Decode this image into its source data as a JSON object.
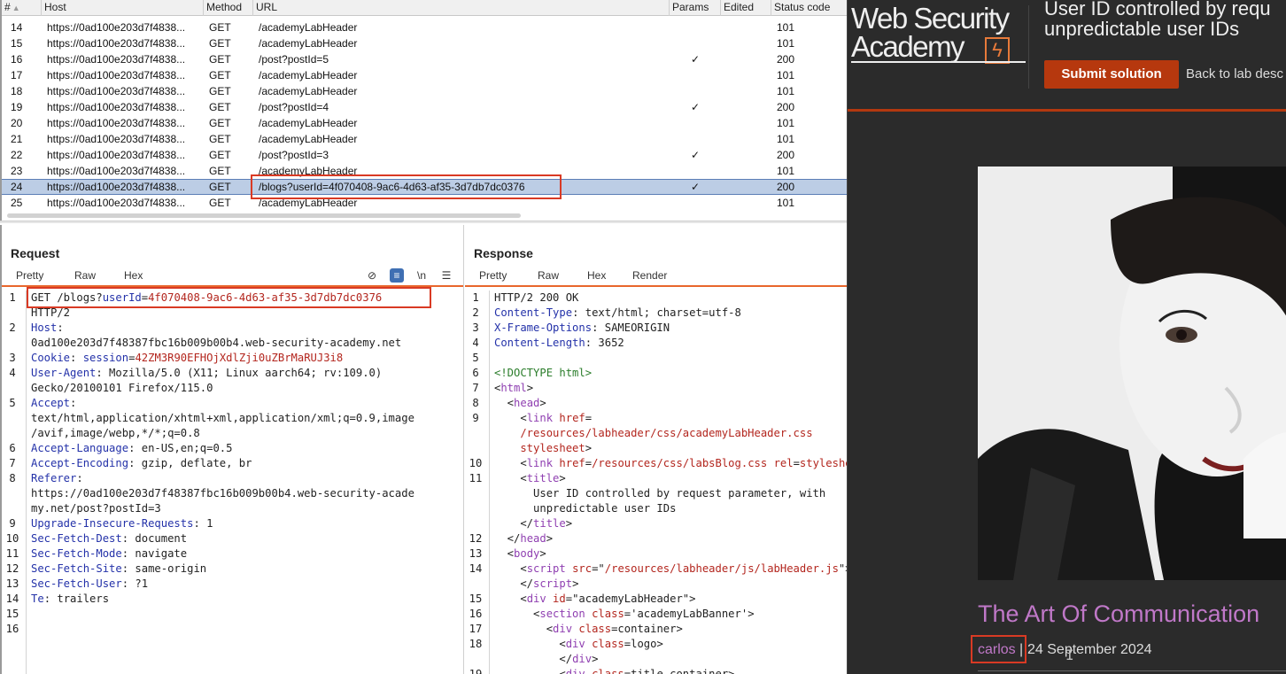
{
  "history": {
    "columns": {
      "num": "#",
      "host": "Host",
      "method": "Method",
      "url": "URL",
      "params": "Params",
      "edited": "Edited",
      "status": "Status code"
    },
    "rows": [
      {
        "num": "14",
        "host": "https://0ad100e203d7f4838...",
        "method": "GET",
        "url": "/academyLabHeader",
        "params": "",
        "status": "101"
      },
      {
        "num": "15",
        "host": "https://0ad100e203d7f4838...",
        "method": "GET",
        "url": "/academyLabHeader",
        "params": "",
        "status": "101"
      },
      {
        "num": "16",
        "host": "https://0ad100e203d7f4838...",
        "method": "GET",
        "url": "/post?postId=5",
        "params": "✓",
        "status": "200"
      },
      {
        "num": "17",
        "host": "https://0ad100e203d7f4838...",
        "method": "GET",
        "url": "/academyLabHeader",
        "params": "",
        "status": "101"
      },
      {
        "num": "18",
        "host": "https://0ad100e203d7f4838...",
        "method": "GET",
        "url": "/academyLabHeader",
        "params": "",
        "status": "101"
      },
      {
        "num": "19",
        "host": "https://0ad100e203d7f4838...",
        "method": "GET",
        "url": "/post?postId=4",
        "params": "✓",
        "status": "200"
      },
      {
        "num": "20",
        "host": "https://0ad100e203d7f4838...",
        "method": "GET",
        "url": "/academyLabHeader",
        "params": "",
        "status": "101"
      },
      {
        "num": "21",
        "host": "https://0ad100e203d7f4838...",
        "method": "GET",
        "url": "/academyLabHeader",
        "params": "",
        "status": "101"
      },
      {
        "num": "22",
        "host": "https://0ad100e203d7f4838...",
        "method": "GET",
        "url": "/post?postId=3",
        "params": "✓",
        "status": "200"
      },
      {
        "num": "23",
        "host": "https://0ad100e203d7f4838...",
        "method": "GET",
        "url": "/academyLabHeader",
        "params": "",
        "status": "101"
      },
      {
        "num": "24",
        "host": "https://0ad100e203d7f4838...",
        "method": "GET",
        "url": "/blogs?userId=4f070408-9ac6-4d63-af35-3d7db7dc0376",
        "params": "✓",
        "status": "200"
      },
      {
        "num": "25",
        "host": "https://0ad100e203d7f4838...",
        "method": "GET",
        "url": "/academyLabHeader",
        "params": "",
        "status": "101"
      }
    ],
    "selected_row": "24"
  },
  "request": {
    "title": "Request",
    "tabs": [
      "Pretty",
      "Raw",
      "Hex"
    ],
    "active_tab": "Pretty",
    "lines": [
      {
        "n": "1",
        "parts": [
          [
            "v",
            "GET /blogs?"
          ],
          [
            "k",
            "userId"
          ],
          [
            "v",
            "="
          ],
          [
            "red",
            "4f070408-9ac6-4d63-af35-3d7db7dc0376"
          ]
        ]
      },
      {
        "n": "",
        "parts": [
          [
            "v",
            "HTTP/2"
          ]
        ]
      },
      {
        "n": "2",
        "parts": [
          [
            "k",
            "Host"
          ],
          [
            "v",
            ":"
          ]
        ]
      },
      {
        "n": "",
        "parts": [
          [
            "v",
            "0ad100e203d7f48387fbc16b009b00b4.web-security-academy.net"
          ]
        ]
      },
      {
        "n": "3",
        "parts": [
          [
            "k",
            "Cookie"
          ],
          [
            "v",
            ": "
          ],
          [
            "k",
            "session"
          ],
          [
            "v",
            "="
          ],
          [
            "red",
            "42ZM3R90EFHOjXdlZji0uZBrMaRUJ3i8"
          ]
        ]
      },
      {
        "n": "4",
        "parts": [
          [
            "k",
            "User-Agent"
          ],
          [
            "v",
            ": Mozilla/5.0 (X11; Linux aarch64; rv:109.0)"
          ]
        ]
      },
      {
        "n": "",
        "parts": [
          [
            "v",
            "Gecko/20100101 Firefox/115.0"
          ]
        ]
      },
      {
        "n": "5",
        "parts": [
          [
            "k",
            "Accept"
          ],
          [
            "v",
            ":"
          ]
        ]
      },
      {
        "n": "",
        "parts": [
          [
            "v",
            "text/html,application/xhtml+xml,application/xml;q=0.9,image"
          ]
        ]
      },
      {
        "n": "",
        "parts": [
          [
            "v",
            "/avif,image/webp,*/*;q=0.8"
          ]
        ]
      },
      {
        "n": "6",
        "parts": [
          [
            "k",
            "Accept-Language"
          ],
          [
            "v",
            ": en-US,en;q=0.5"
          ]
        ]
      },
      {
        "n": "7",
        "parts": [
          [
            "k",
            "Accept-Encoding"
          ],
          [
            "v",
            ": gzip, deflate, br"
          ]
        ]
      },
      {
        "n": "8",
        "parts": [
          [
            "k",
            "Referer"
          ],
          [
            "v",
            ":"
          ]
        ]
      },
      {
        "n": "",
        "parts": [
          [
            "v",
            "https://0ad100e203d7f48387fbc16b009b00b4.web-security-acade"
          ]
        ]
      },
      {
        "n": "",
        "parts": [
          [
            "v",
            "my.net/post?postId=3"
          ]
        ]
      },
      {
        "n": "9",
        "parts": [
          [
            "k",
            "Upgrade-Insecure-Requests"
          ],
          [
            "v",
            ": 1"
          ]
        ]
      },
      {
        "n": "10",
        "parts": [
          [
            "k",
            "Sec-Fetch-Dest"
          ],
          [
            "v",
            ": document"
          ]
        ]
      },
      {
        "n": "11",
        "parts": [
          [
            "k",
            "Sec-Fetch-Mode"
          ],
          [
            "v",
            ": navigate"
          ]
        ]
      },
      {
        "n": "12",
        "parts": [
          [
            "k",
            "Sec-Fetch-Site"
          ],
          [
            "v",
            ": same-origin"
          ]
        ]
      },
      {
        "n": "13",
        "parts": [
          [
            "k",
            "Sec-Fetch-User"
          ],
          [
            "v",
            ": ?1"
          ]
        ]
      },
      {
        "n": "14",
        "parts": [
          [
            "k",
            "Te"
          ],
          [
            "v",
            ": trailers"
          ]
        ]
      },
      {
        "n": "15",
        "parts": []
      },
      {
        "n": "16",
        "parts": []
      }
    ]
  },
  "response": {
    "title": "Response",
    "tabs": [
      "Pretty",
      "Raw",
      "Hex",
      "Render"
    ],
    "active_tab": "Pretty",
    "lines": [
      {
        "n": "1",
        "parts": [
          [
            "v",
            "HTTP/2 200 OK"
          ]
        ]
      },
      {
        "n": "2",
        "parts": [
          [
            "k",
            "Content-Type"
          ],
          [
            "v",
            ": text/html; charset=utf-8"
          ]
        ]
      },
      {
        "n": "3",
        "parts": [
          [
            "k",
            "X-Frame-Options"
          ],
          [
            "v",
            ": SAMEORIGIN"
          ]
        ]
      },
      {
        "n": "4",
        "parts": [
          [
            "k",
            "Content-Length"
          ],
          [
            "v",
            ": 3652"
          ]
        ]
      },
      {
        "n": "5",
        "parts": []
      },
      {
        "n": "6",
        "parts": [
          [
            "doct",
            "<!DOCTYPE html>"
          ]
        ]
      },
      {
        "n": "7",
        "parts": [
          [
            "v",
            "<"
          ],
          [
            "tag",
            "html"
          ],
          [
            "v",
            ">"
          ]
        ]
      },
      {
        "n": "8",
        "parts": [
          [
            "v",
            "  <"
          ],
          [
            "tag",
            "head"
          ],
          [
            "v",
            ">"
          ]
        ]
      },
      {
        "n": "9",
        "parts": [
          [
            "v",
            "    <"
          ],
          [
            "tag",
            "link"
          ],
          [
            "v",
            " "
          ],
          [
            "attr",
            "href"
          ],
          [
            "v",
            "="
          ]
        ]
      },
      {
        "n": "",
        "parts": [
          [
            "red",
            "    /resources/labheader/css/academyLabHeader.css"
          ]
        ]
      },
      {
        "n": "",
        "parts": [
          [
            "red",
            "    stylesheet"
          ],
          [
            "v",
            ">"
          ]
        ]
      },
      {
        "n": "10",
        "parts": [
          [
            "v",
            "    <"
          ],
          [
            "tag",
            "link"
          ],
          [
            "v",
            " "
          ],
          [
            "attr",
            "href"
          ],
          [
            "v",
            "="
          ],
          [
            "red",
            "/resources/css/labsBlog.css"
          ],
          [
            "v",
            " "
          ],
          [
            "attr",
            "rel"
          ],
          [
            "v",
            "="
          ],
          [
            "red",
            "stylesheet"
          ]
        ]
      },
      {
        "n": "11",
        "parts": [
          [
            "v",
            "    <"
          ],
          [
            "tag",
            "title"
          ],
          [
            "v",
            ">"
          ]
        ]
      },
      {
        "n": "",
        "parts": [
          [
            "v",
            "      User ID controlled by request parameter, with"
          ]
        ]
      },
      {
        "n": "",
        "parts": [
          [
            "v",
            "      unpredictable user IDs"
          ]
        ]
      },
      {
        "n": "",
        "parts": [
          [
            "v",
            "    </"
          ],
          [
            "tag",
            "title"
          ],
          [
            "v",
            ">"
          ]
        ]
      },
      {
        "n": "12",
        "parts": [
          [
            "v",
            "  </"
          ],
          [
            "tag",
            "head"
          ],
          [
            "v",
            ">"
          ]
        ]
      },
      {
        "n": "13",
        "parts": [
          [
            "v",
            "  <"
          ],
          [
            "tag",
            "body"
          ],
          [
            "v",
            ">"
          ]
        ]
      },
      {
        "n": "14",
        "parts": [
          [
            "v",
            "    <"
          ],
          [
            "tag",
            "script"
          ],
          [
            "v",
            " "
          ],
          [
            "attr",
            "src"
          ],
          [
            "v",
            "=\""
          ],
          [
            "red",
            "/resources/labheader/js/labHeader.js"
          ],
          [
            "v",
            "\">"
          ]
        ]
      },
      {
        "n": "",
        "parts": [
          [
            "v",
            "    </"
          ],
          [
            "tag",
            "script"
          ],
          [
            "v",
            ">"
          ]
        ]
      },
      {
        "n": "15",
        "parts": [
          [
            "v",
            "    <"
          ],
          [
            "tag",
            "div"
          ],
          [
            "v",
            " "
          ],
          [
            "attr",
            "id"
          ],
          [
            "v",
            "=\"academyLabHeader\">"
          ]
        ]
      },
      {
        "n": "16",
        "parts": [
          [
            "v",
            "      <"
          ],
          [
            "tag",
            "section"
          ],
          [
            "v",
            " "
          ],
          [
            "attr",
            "class"
          ],
          [
            "v",
            "='academyLabBanner'>"
          ]
        ]
      },
      {
        "n": "17",
        "parts": [
          [
            "v",
            "        <"
          ],
          [
            "tag",
            "div"
          ],
          [
            "v",
            " "
          ],
          [
            "attr",
            "class"
          ],
          [
            "v",
            "=container>"
          ]
        ]
      },
      {
        "n": "18",
        "parts": [
          [
            "v",
            "          <"
          ],
          [
            "tag",
            "div"
          ],
          [
            "v",
            " "
          ],
          [
            "attr",
            "class"
          ],
          [
            "v",
            "=logo>"
          ]
        ]
      },
      {
        "n": "",
        "parts": [
          [
            "v",
            "          </"
          ],
          [
            "tag",
            "div"
          ],
          [
            "v",
            ">"
          ]
        ]
      },
      {
        "n": "19",
        "parts": [
          [
            "v",
            "          <"
          ],
          [
            "tag",
            "div"
          ],
          [
            "v",
            " "
          ],
          [
            "attr",
            "class"
          ],
          [
            "v",
            "=title-container>"
          ]
        ]
      }
    ]
  },
  "browser": {
    "logo_line1": "Web Security",
    "logo_line2": "Academy",
    "logo_mark": "ϟ",
    "lab_title_line1": "User ID controlled by requ",
    "lab_title_line2": "unpredictable user IDs",
    "submit_label": "Submit solution",
    "back_link": "Back to lab desc",
    "post_title": "The Art Of Communication",
    "author": "carlos",
    "separator": "|",
    "date": "24 September 2024"
  }
}
